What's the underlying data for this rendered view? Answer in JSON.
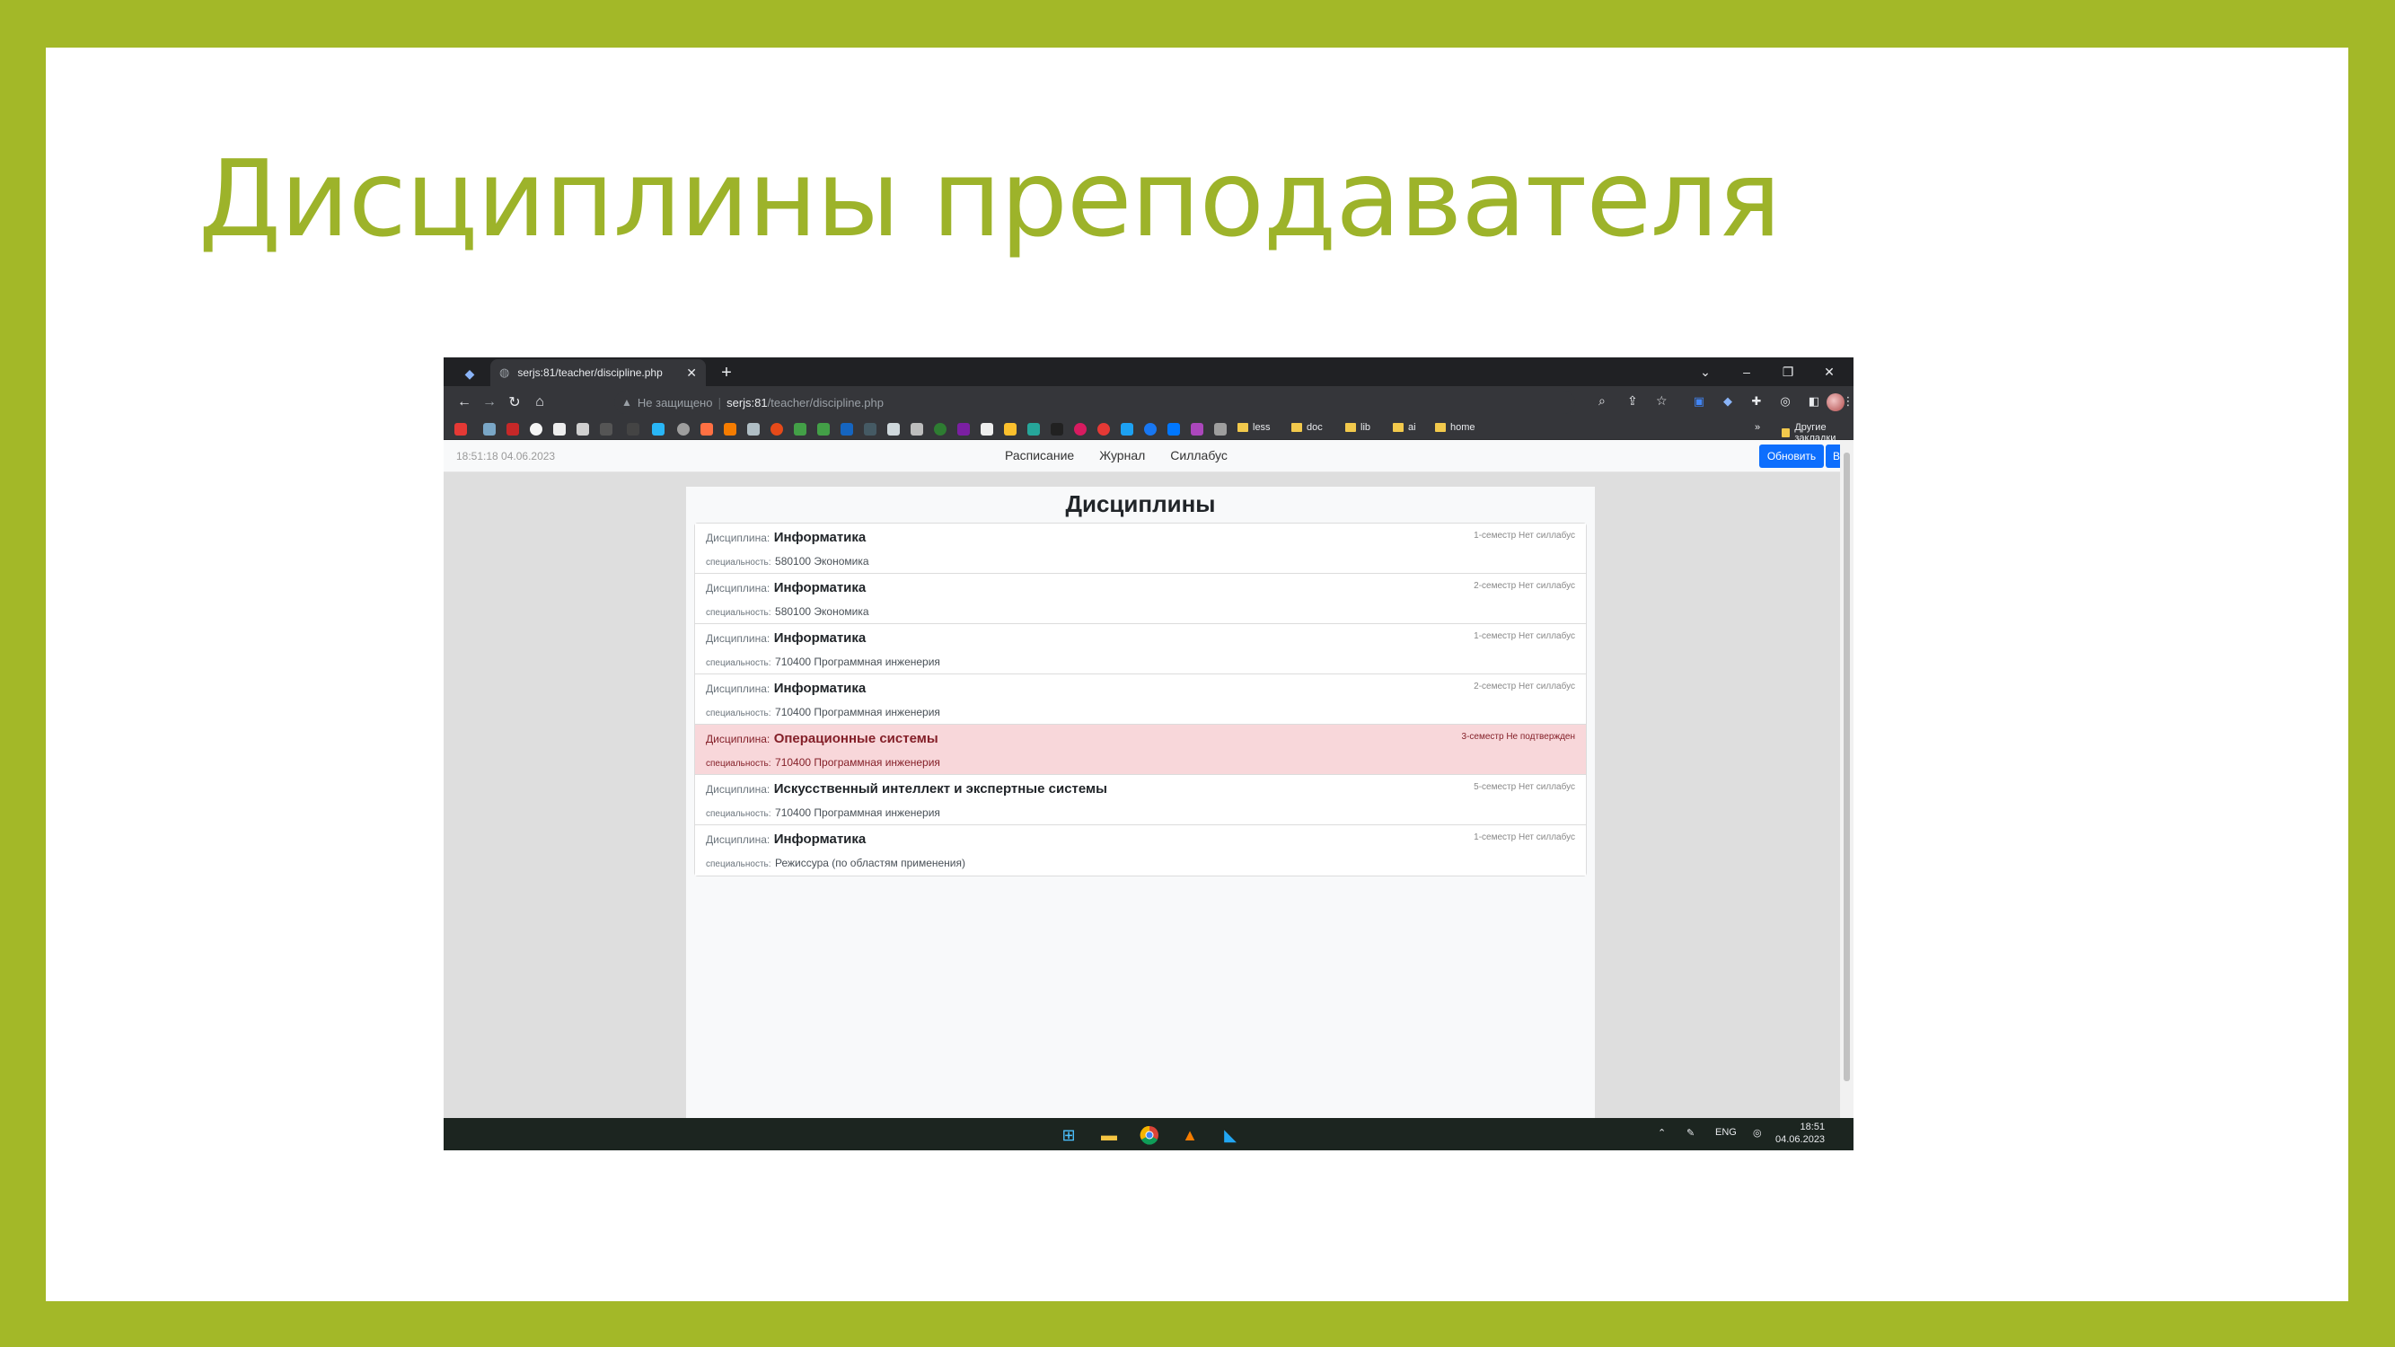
{
  "slide": {
    "title": "Дисциплины преподавателя"
  },
  "browser": {
    "tab_title": "serjs:81/teacher/discipline.php",
    "tab_close": "✕",
    "new_tab": "+",
    "insecure_label": "Не защищено",
    "url_host": "serjs:81",
    "url_path": "/teacher/discipline.php",
    "bookmarks": [
      {
        "label": "less"
      },
      {
        "label": "doc"
      },
      {
        "label": "lib"
      },
      {
        "label": "ai"
      },
      {
        "label": "home"
      }
    ],
    "other_bookmarks": "Другие закладки",
    "more_bookmarks": "»"
  },
  "app": {
    "clock": "18:51:18 04.06.2023",
    "nav": [
      "Расписание",
      "Журнал",
      "Силлабус"
    ],
    "refresh_label": "Обновить",
    "logout_label": "Выход",
    "card_title": "Дисциплины",
    "discipline_label": "Дисциплина:",
    "specialty_label": "специальность:",
    "items": [
      {
        "name": "Информатика",
        "specialty": "580100 Экономика",
        "semester": "1-семестр Нет силлабус",
        "highlight": false
      },
      {
        "name": "Информатика",
        "specialty": "580100 Экономика",
        "semester": "2-семестр Нет силлабус",
        "highlight": false
      },
      {
        "name": "Информатика",
        "specialty": "710400 Программная инженерия",
        "semester": "1-семестр Нет силлабус",
        "highlight": false
      },
      {
        "name": "Информатика",
        "specialty": "710400 Программная инженерия",
        "semester": "2-семестр Нет силлабус",
        "highlight": false
      },
      {
        "name": "Операционные системы",
        "specialty": "710400 Программная инженерия",
        "semester": "3-семестр Не подтвержден",
        "highlight": true
      },
      {
        "name": "Искусственный интеллект и экспертные системы",
        "specialty": "710400 Программная инженерия",
        "semester": "5-семестр Нет силлабус",
        "highlight": false
      },
      {
        "name": "Информатика",
        "specialty": "Режиссура (по областям применения)",
        "semester": "1-семестр Нет силлабус",
        "highlight": false
      }
    ]
  },
  "taskbar": {
    "lang": "ENG",
    "time": "18:51",
    "date": "04.06.2023"
  },
  "colors": {
    "frame": "#a3b828",
    "title": "#9db32a",
    "primary_button": "#0d6efd",
    "danger_row": "#f8d7da"
  }
}
